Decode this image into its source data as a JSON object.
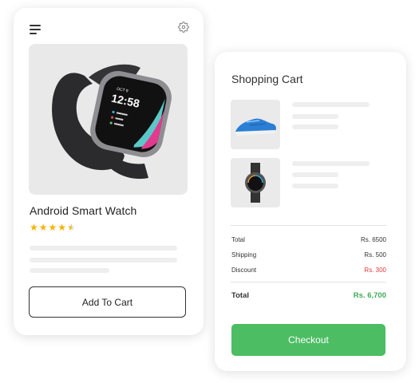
{
  "product": {
    "name": "Android Smart Watch",
    "rating": 4.5,
    "rating_max": 5,
    "add_to_cart_label": "Add To Cart",
    "watch_time": "12:58",
    "watch_date": "OCT 9"
  },
  "icons": {
    "menu": "hamburger-menu-icon",
    "settings": "gear-icon",
    "star": "star-icon"
  },
  "cart": {
    "title": "Shopping Cart",
    "items": [
      {
        "image": "blue-sneaker"
      },
      {
        "image": "smart-watch"
      }
    ],
    "summary": {
      "total_label": "Total",
      "total_value": "Rs. 6500",
      "shipping_label": "Shipping",
      "shipping_value": "Rs. 500",
      "discount_label": "Discount",
      "discount_value": "Rs. 300",
      "grand_total_label": "Total",
      "grand_total_value": "Rs. 6,700"
    },
    "checkout_label": "Checkout"
  },
  "colors": {
    "accent_green": "#4cbd63",
    "discount_red": "#e0393e",
    "star_yellow": "#f5b400"
  }
}
